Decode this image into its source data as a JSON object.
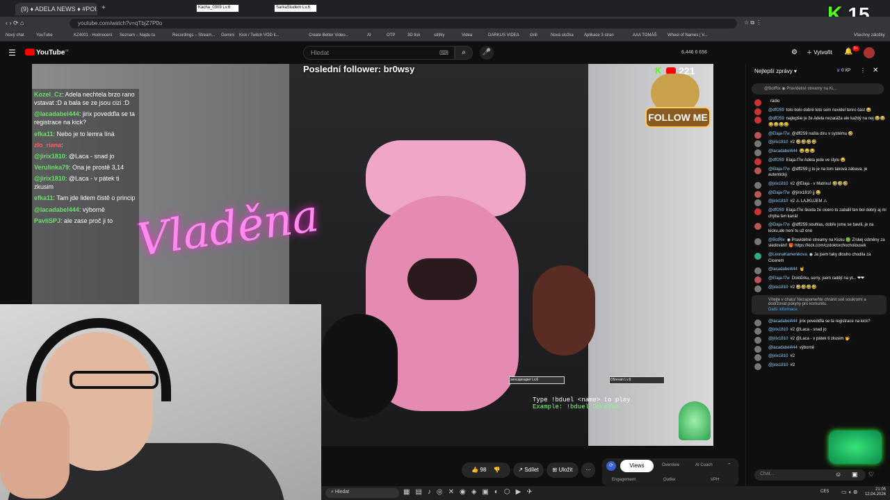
{
  "browser": {
    "tabs": [
      {
        "label": "(9) ♦ ADELA NEWS ♦ #POI..."
      },
      {
        "label": "Kacha_0309  Lv.6"
      },
      {
        "label": "SarkaStudem  Lv.6"
      }
    ],
    "url": "youtube.com/watch?v=qTbjZ7P0o",
    "bookmarks": [
      "Nový chat",
      "YouTube",
      "KZ4001 - Hodnocení",
      "Seznam – Najdu tu",
      "Recordings – Stream...",
      "Gemini",
      "Kick / Twitch VOD li...",
      "Create Better Video...",
      "AI",
      "OTP",
      "3D tisk",
      "sdílky",
      "Videa",
      "DARKUS VIDEA",
      "Grill",
      "Nová složka",
      "Aplikace 3 stran",
      "AAA TOMÁŠ",
      "Wheel of Names | V...",
      "Všechny záložky"
    ]
  },
  "stream_overlay_badge": "15",
  "youtube": {
    "logo": "YouTube",
    "logo_sup": "CZ",
    "search_placeholder": "Hledat",
    "stats": "6,446  6  656",
    "create_label": "Vytvořit",
    "notif_count": "9+"
  },
  "video": {
    "last_follower": "Poslední follower: br0wsy",
    "kick_viewers": "221",
    "follow_me": "FOLLOW ME",
    "neon_sign": "Vladěna",
    "bduel_line1": "Type !bduel <name> to play",
    "bduel_line2": "Example: !bduel D5revan",
    "hp1_label": "sencajesuper Lv.6",
    "hp2_label": "D5revan Lv.6",
    "overlay_chat": [
      {
        "user": "Kozel_Cz",
        "text": ": Adela nechtela brzo rano vstavat :D a bala se ze jsou cizi :D"
      },
      {
        "user": "@lacadabel444",
        "text": ": jirix povedďla se ta registrace na kick?"
      },
      {
        "user": "efka11",
        "text": ": Nebo je to lemra líná"
      },
      {
        "user": "zlo_riana",
        "text": ":"
      },
      {
        "user": "@jirix1810",
        "text": ": @Laca - snad jo"
      },
      {
        "user": "Verulinka79",
        "text": ": Ona je prostě 3,14"
      },
      {
        "user": "@jirix1810",
        "text": ": @Laca - v pátek ti zkusim"
      },
      {
        "user": "efka11",
        "text": ": Tam jde lidem čistě o princip"
      },
      {
        "user": "@lacadabel444",
        "text": ": výborně"
      },
      {
        "user": "PavliSPJ",
        "text": ": ale zase proč ji to"
      }
    ]
  },
  "video_actions": {
    "like_count": "98",
    "share_label": "Sdílet",
    "save_label": "Uložit",
    "more_label": "···"
  },
  "studio_tabs": {
    "tab1": "Views",
    "tab2": "Overview",
    "tab3": "AI Coach",
    "row2_1": "Engagement",
    "row2_2": "Outlier",
    "row2_3": "VPH"
  },
  "chat": {
    "header": "Nejlepší zprávy",
    "xp": "0 XP",
    "pinned": "@BotRix ◉ Pravidelné streamy na Ki...",
    "input_placeholder": "Chat...",
    "system_notice": "Vítejte v chatu! Nezapomeňte chránit své soukromí a dodržovat pokyny pro komunitu.",
    "system_link": "Další informace",
    "messages": [
      {
        "name": "",
        "text": "rádio",
        "color": "#c33"
      },
      {
        "name": "@dff259",
        "text": "toto bolo dobré toto som nevidel tenro čast 😂",
        "color": "#c33"
      },
      {
        "name": "@dff259",
        "text": "najlepšie je že Adela nezaráža ale každý na nej 😂😂😂😂😂😂",
        "color": "#c33"
      },
      {
        "name": "@Elaja-f7w",
        "text": "@dff259 našla díru v systému 🤣",
        "color": "#b55"
      },
      {
        "name": "@jirix1810",
        "text": "#2 🤣🤣🤣🤣",
        "color": "#777"
      },
      {
        "name": "@lacadabel444",
        "text": "😂😂😂",
        "color": "#777"
      },
      {
        "name": "@dff259",
        "text": "Elaja-f7w Adela jede ve stylu 😂",
        "color": "#c33"
      },
      {
        "name": "@Elaja-f7w",
        "text": "@dff259 jj to je na tom taková zábava, je autentický",
        "color": "#b55"
      },
      {
        "name": "@jirix1810",
        "text": "#2 @Elaja - v Matrixu! 🤣🤣🤣",
        "color": "#777"
      },
      {
        "name": "@Elaja-f7w",
        "text": "@jirix1810 jj 😂",
        "color": "#b55"
      },
      {
        "name": "@jirix1810",
        "text": "#2 ⚠ LAJKUJEM ⚠",
        "color": "#777"
      },
      {
        "name": "@dff259",
        "text": "Elaja-f7w škoda že cicero to zabalil ten bol dobrý aj mi chýba ten kanál",
        "color": "#c33"
      },
      {
        "name": "@Elaja-f7w",
        "text": "@dff259 souhlas, dobře jsme se bavili, je na kicku,ale není tu už ono",
        "color": "#b55"
      },
      {
        "name": "@BotRix",
        "text": "◉ Pravidelné streamy na Kicku 🟢 Získej odměny za sledování! 🎁 https://kick.com/czdoktorchocholousek",
        "color": "#777"
      },
      {
        "name": "@LeonaKamenikova",
        "text": "◉ Ja jsem taky dlouho chodila za Cicerem",
        "color": "#3a8"
      },
      {
        "name": "@lacadabel444",
        "text": "🤘",
        "color": "#777"
      },
      {
        "name": "@Elaja-f7w",
        "text": "Doktůrku, sorry, jsem radějí na yt... ❤❤",
        "color": "#b55"
      },
      {
        "name": "@jirix1810",
        "text": "#2 🤣🤣🤣🤣",
        "color": "#777"
      }
    ],
    "messages_after": [
      {
        "name": "@lacadabel444",
        "text": "jirix povedďla se ta registrace na kick?",
        "color": "#777"
      },
      {
        "name": "@jirix1810",
        "text": "#2 @Laca - snad jo",
        "color": "#777"
      },
      {
        "name": "@jirix1810",
        "text": "#2 @Laca - v pátek ti zkusim 🤟",
        "color": "#777"
      },
      {
        "name": "@lacadabel444",
        "text": "výborně",
        "color": "#777"
      },
      {
        "name": "@jirix1810",
        "text": "#2",
        "color": "#777"
      },
      {
        "name": "@jirix1810",
        "text": "#2",
        "color": "#777"
      }
    ]
  },
  "taskbar": {
    "search_placeholder": "Hledat",
    "lang": "CES",
    "time": "21:05",
    "date": "12.04.2026"
  },
  "colors": {
    "youtube_red": "#ff0000",
    "kick_green": "#53fc18",
    "chat_name": "#8fd2ff"
  }
}
